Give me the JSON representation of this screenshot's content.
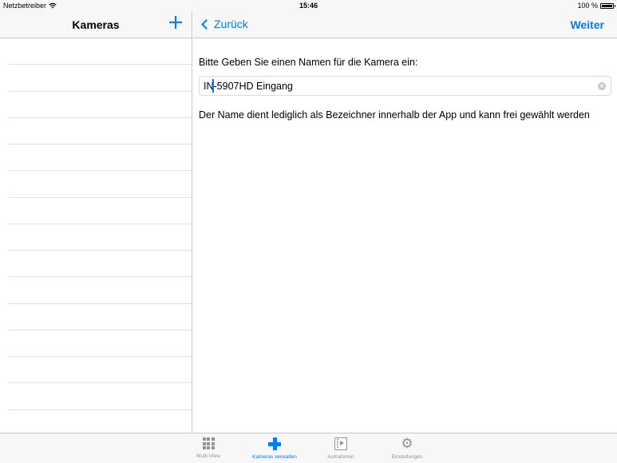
{
  "status_bar": {
    "carrier": "Netzbetreiber",
    "time": "15:46",
    "battery": "100 %",
    "battery_level": 1.0
  },
  "master": {
    "title": "Kameras",
    "add_icon": "plus-icon",
    "row_count": 14
  },
  "detail": {
    "back_label": "Zurück",
    "next_label": "Weiter",
    "prompt": "Bitte Geben Sie einen Namen für die Kamera ein:",
    "name_value": "IN-5907HD Eingang",
    "hint": "Der Name dient lediglich als Bezeichner innerhalb der App und kann frei gewählt werden"
  },
  "tabbar": {
    "tabs": [
      {
        "label": "Multi-View",
        "icon": "grid-icon",
        "active": false
      },
      {
        "label": "Kameras verwalten",
        "icon": "plus-icon",
        "active": true
      },
      {
        "label": "Aufnahmen",
        "icon": "film-icon",
        "active": false
      },
      {
        "label": "Einstellungen",
        "icon": "gear-icon",
        "active": false
      }
    ]
  },
  "colors": {
    "accent": "#007aff",
    "bar_background": "#f7f7f8",
    "separator": "#c8c7cc",
    "inactive_tab": "#929292"
  }
}
